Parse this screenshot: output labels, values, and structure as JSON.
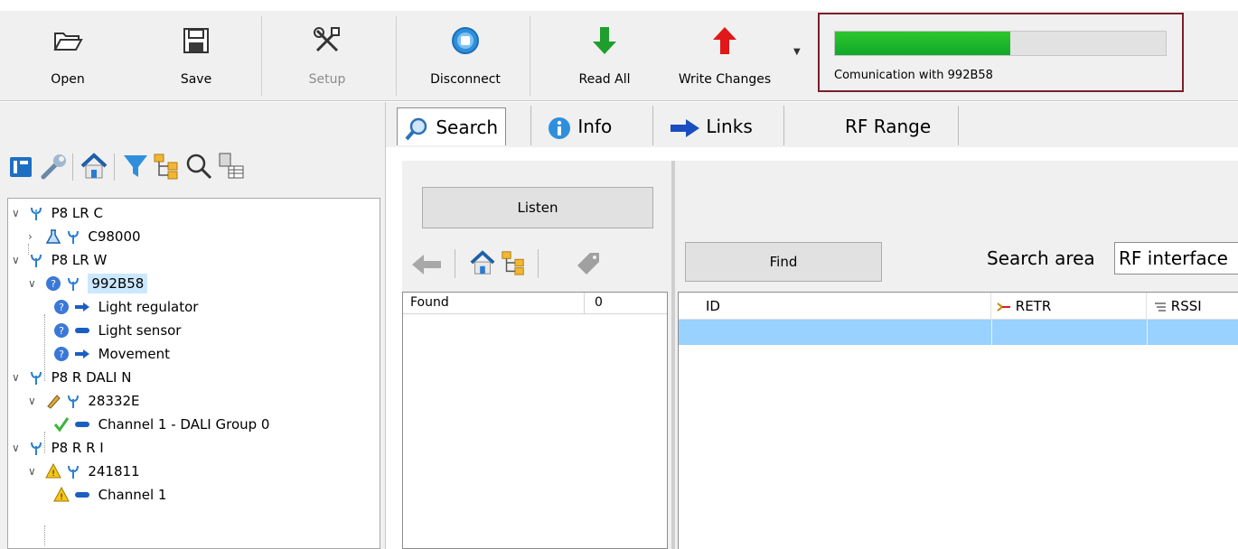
{
  "toolbar": {
    "open": "Open",
    "save": "Save",
    "setup": "Setup",
    "disconnect": "Disconnect",
    "read_all": "Read All",
    "write_changes": "Write Changes"
  },
  "communication": {
    "text": "Comunication with  992B58",
    "progress": 0.53,
    "color": "#1bb52b"
  },
  "left_toolbar_icons": [
    "info-panel-icon",
    "wrench-icon",
    "home-icon",
    "filter-icon",
    "tree-icon",
    "magnifier-icon",
    "device-list-icon"
  ],
  "tree": [
    {
      "label": "P8 LR C",
      "level": 0,
      "expanded": true
    },
    {
      "label": "C98000",
      "level": 1,
      "expanded": false
    },
    {
      "label": "P8 LR W",
      "level": 0,
      "expanded": true
    },
    {
      "label": "992B58",
      "level": 1,
      "expanded": true,
      "selected": true
    },
    {
      "label": "Light regulator",
      "level": 2
    },
    {
      "label": "Light sensor",
      "level": 2
    },
    {
      "label": "Movement",
      "level": 2
    },
    {
      "label": "P8 R DALI N",
      "level": 0,
      "expanded": true
    },
    {
      "label": "28332E",
      "level": 1,
      "expanded": true
    },
    {
      "label": "Channel 1 - DALI Group 0",
      "level": 2
    },
    {
      "label": "P8 R R I",
      "level": 0,
      "expanded": true
    },
    {
      "label": "241811",
      "level": 1,
      "expanded": true
    },
    {
      "label": "Channel 1",
      "level": 2
    }
  ],
  "tabs": [
    "Search",
    "Info",
    "Links",
    "RF Range"
  ],
  "search": {
    "listen": "Listen",
    "find": "Find",
    "found_label": "Found",
    "found_count": "0",
    "search_area_label": "Search area",
    "search_area_value": "RF interface",
    "columns": [
      "ID",
      "RETR",
      "RSSI"
    ]
  }
}
